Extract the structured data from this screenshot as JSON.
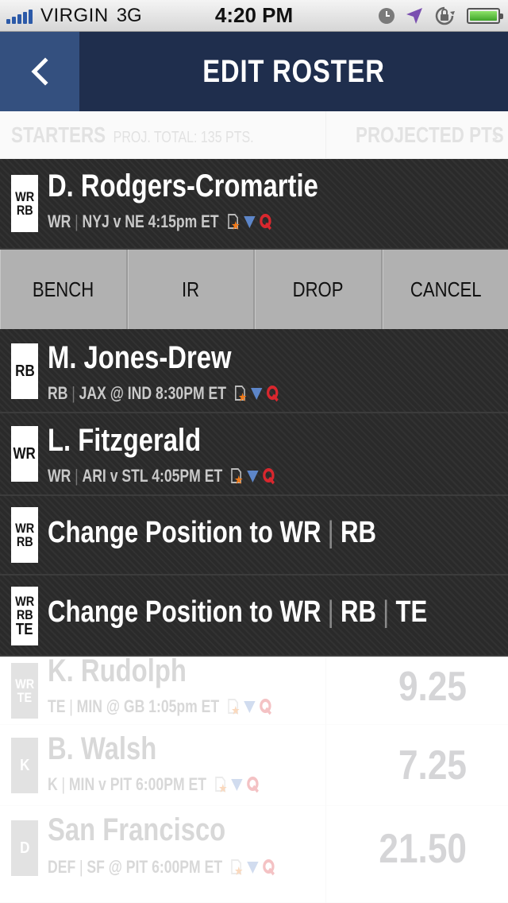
{
  "status_bar": {
    "carrier": "VIRGIN",
    "network": "3G",
    "time": "4:20 PM",
    "icons": [
      "clock-icon",
      "location-arrow-icon",
      "rotation-lock-icon",
      "battery-icon"
    ]
  },
  "nav": {
    "back_icon": "chevron-left-icon",
    "title": "EDIT ROSTER"
  },
  "section_header": {
    "starters": "STARTERS",
    "proj_total": "PROJ. TOTAL: 135 PTS.",
    "projected_pts": "PROJECTED PTS"
  },
  "selected_player": {
    "pos_top": "WR",
    "pos_bottom": "RB",
    "name": "D. Rodgers-Cromartie",
    "position": "WR",
    "game": "NYJ v NE 4:15pm ET"
  },
  "actions": {
    "bench": "BENCH",
    "ir": "IR",
    "drop": "DROP",
    "cancel": "CANCEL"
  },
  "swap_players": [
    {
      "pos_label": "RB",
      "name": "M. Jones-Drew",
      "position": "RB",
      "game": "JAX @ IND 8:30PM ET"
    },
    {
      "pos_label": "WR",
      "name": "L. Fitzgerald",
      "position": "WR",
      "game": "ARI v STL 4:05PM ET"
    }
  ],
  "change_options": [
    {
      "pos_lines": [
        "WR",
        "RB"
      ],
      "prefix": "Change Position to WR",
      "parts": [
        "RB"
      ]
    },
    {
      "pos_lines": [
        "WR",
        "RB",
        "TE"
      ],
      "prefix": "Change Position to WR",
      "parts": [
        "RB",
        "TE"
      ]
    }
  ],
  "background_players": [
    {
      "pos_lines": [
        "WR",
        "TE"
      ],
      "name": "K. Rudolph",
      "position": "TE",
      "game": "MIN @ GB 1:05pm ET",
      "points": "9.25"
    },
    {
      "pos_lines": [
        "K"
      ],
      "name": "B. Walsh",
      "position": "K",
      "game": "MIN v PIT 6:00PM ET",
      "points": "7.25"
    },
    {
      "pos_lines": [
        "D"
      ],
      "name": "San Francisco",
      "position": "DEF",
      "game": "SF @ PIT 6:00PM ET",
      "points": "21.50"
    }
  ],
  "colors": {
    "nav_bg": "#1f2e4d",
    "back_bg": "#34507f",
    "panel_bg": "#2a2a2a",
    "action_bg": "#b3b3b3",
    "signal_blue": "#2c5aa8",
    "news_orange": "#f07a1a",
    "trend_blue": "#5d86c9",
    "questionable_red": "#d9272e"
  }
}
